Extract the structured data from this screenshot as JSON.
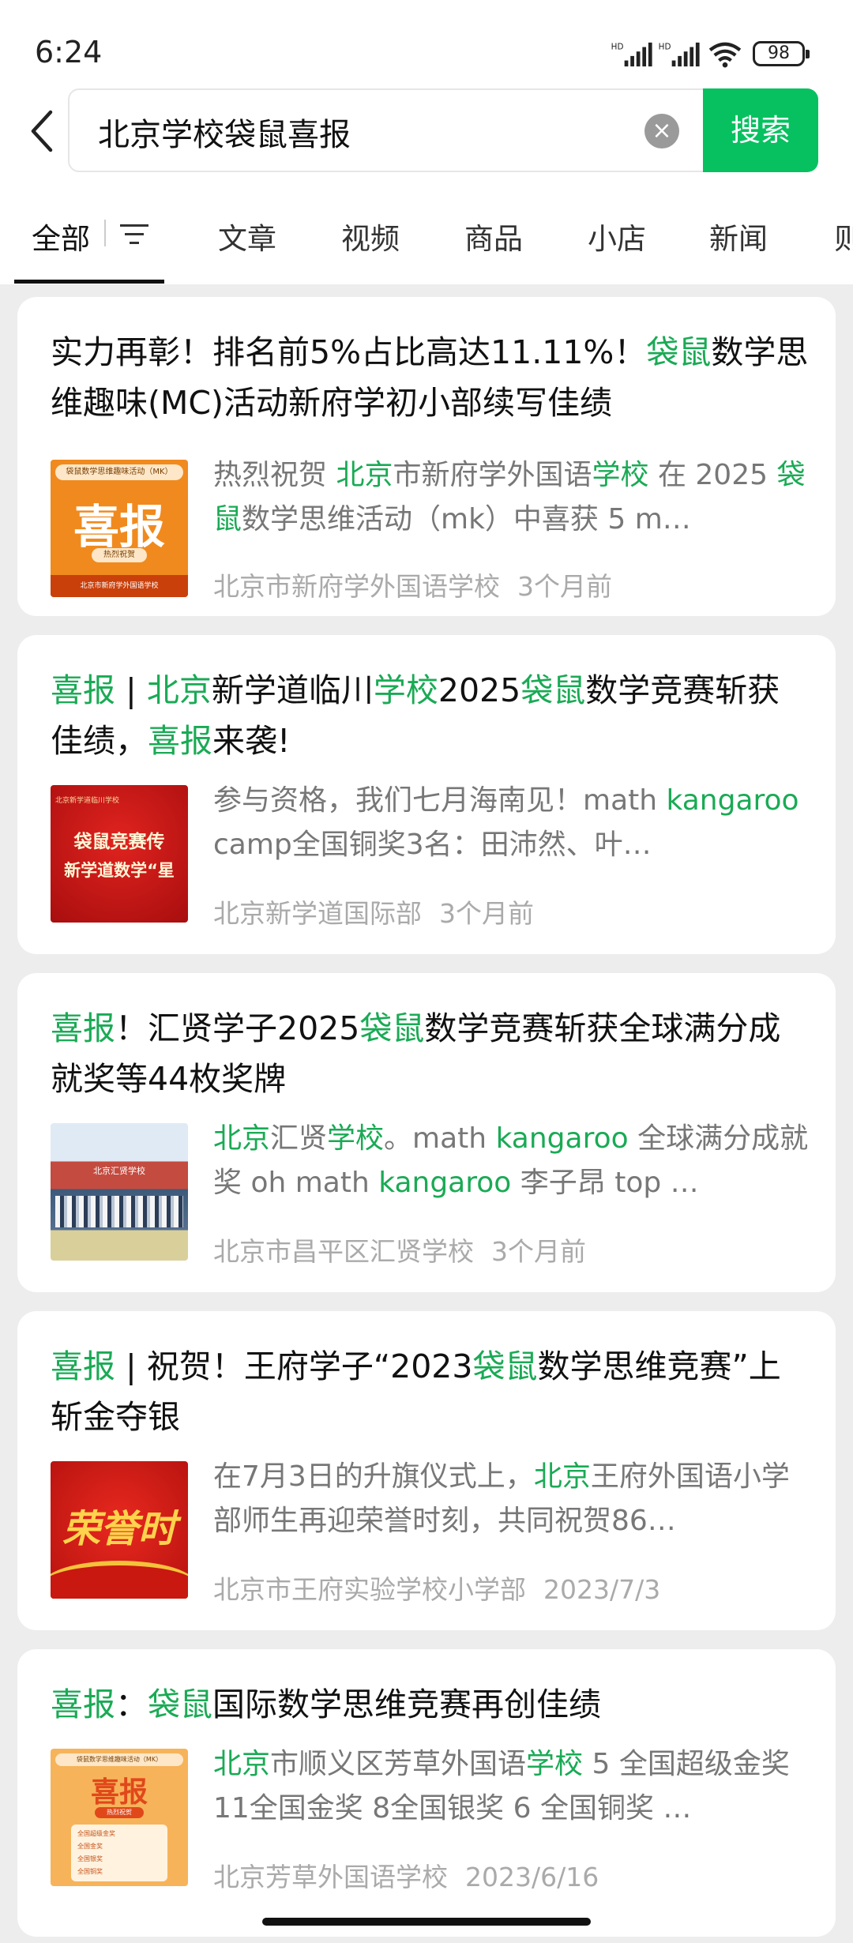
{
  "status": {
    "time": "6:24",
    "signal1": "HD",
    "signal2": "HD",
    "battery": "98"
  },
  "search": {
    "query": "北京学校袋鼠喜报",
    "button": "搜索"
  },
  "tabs": [
    "全部",
    "文章",
    "视频",
    "商品",
    "小店",
    "新闻",
    "则"
  ],
  "results": [
    {
      "title": [
        [
          "实力再彰！排名前5%占比高达11.11%！",
          0
        ],
        [
          "袋鼠",
          1
        ],
        [
          "数学思维趣味(MC)活动新府学初小部续写佳绩",
          0
        ]
      ],
      "snippet": [
        [
          "热烈祝贺 ",
          0
        ],
        [
          "北京",
          1
        ],
        [
          "市新府学外国语",
          0
        ],
        [
          "学校",
          1
        ],
        [
          " 在 2025 ",
          0
        ],
        [
          "袋鼠",
          1
        ],
        [
          "数学思维活动（mk）中喜获 5 m…",
          0
        ]
      ],
      "source": "北京市新府学外国语学校",
      "time": "3个月前",
      "thumb": {
        "top": "袋鼠数学思维趣味活动（MK）",
        "big": "喜报",
        "sub": "热烈祝贺",
        "bottom": "北京市新府学外国语学校"
      }
    },
    {
      "title": [
        [
          "喜报",
          1
        ],
        [
          " | ",
          0
        ],
        [
          "北京",
          1
        ],
        [
          "新学道临川",
          0
        ],
        [
          "学校",
          1
        ],
        [
          "2025",
          0
        ],
        [
          "袋鼠",
          1
        ],
        [
          "数学竞赛斩获佳绩，",
          0
        ],
        [
          "喜报",
          1
        ],
        [
          "来袭!",
          0
        ]
      ],
      "snippet": [
        [
          "参与资格，我们七月海南见！math ",
          0
        ],
        [
          "kangaroo",
          1
        ],
        [
          " camp全国铜奖3名：田沛然、叶…",
          0
        ]
      ],
      "source": "北京新学道国际部",
      "time": "3个月前",
      "thumb": {
        "top": "北京新学道临川学校",
        "l1": "袋鼠竞赛传",
        "l2": "新学道数学“星"
      }
    },
    {
      "title": [
        [
          "喜报",
          1
        ],
        [
          "！汇贤学子2025",
          0
        ],
        [
          "袋鼠",
          1
        ],
        [
          "数学竞赛斩获全球满分成就奖等44枚奖牌",
          0
        ]
      ],
      "snippet": [
        [
          "北京",
          1
        ],
        [
          "汇贤",
          0
        ],
        [
          "学校",
          1
        ],
        [
          "。math ",
          0
        ],
        [
          "kangaroo",
          1
        ],
        [
          " 全球满分成就奖 oh math ",
          0
        ],
        [
          "kangaroo",
          1
        ],
        [
          " 李子昂 top …",
          0
        ]
      ],
      "source": "北京市昌平区汇贤学校",
      "time": "3个月前",
      "thumb": {
        "top": "北京汇贤学校"
      }
    },
    {
      "title": [
        [
          "喜报",
          1
        ],
        [
          " | 祝贺！王府学子“2023",
          0
        ],
        [
          "袋鼠",
          1
        ],
        [
          "数学思维竞赛”上斩金夺银",
          0
        ]
      ],
      "snippet": [
        [
          "在7月3日的升旗仪式上，",
          0
        ],
        [
          "北京",
          1
        ],
        [
          "王府外国语小学部师生再迎荣誉时刻，共同祝贺86…",
          0
        ]
      ],
      "source": "北京市王府实验学校小学部",
      "time": "2023/7/3",
      "thumb": {
        "big": "荣誉时"
      }
    },
    {
      "title": [
        [
          "喜报",
          1
        ],
        [
          "：",
          0
        ],
        [
          "袋鼠",
          1
        ],
        [
          "国际数学思维竞赛再创佳绩",
          0
        ]
      ],
      "snippet": [
        [
          "北京",
          1
        ],
        [
          "市顺义区芳草外国语",
          0
        ],
        [
          "学校",
          1
        ],
        [
          " 5 全国超级金奖 11全国金奖 8全国银奖 6 全国铜奖 …",
          0
        ]
      ],
      "source": "北京芳草外国语学校",
      "time": "2023/6/16",
      "thumb": {
        "top": "袋鼠数学思维趣味活动（MK）",
        "big": "喜报",
        "sub": "热烈祝贺",
        "items": [
          "全国超级金奖",
          "全国金奖",
          "全国银奖",
          "全国铜奖"
        ]
      }
    }
  ],
  "colors": {
    "accent": "#07c160",
    "highlight": "#1aaa55",
    "bg": "#ededed"
  }
}
